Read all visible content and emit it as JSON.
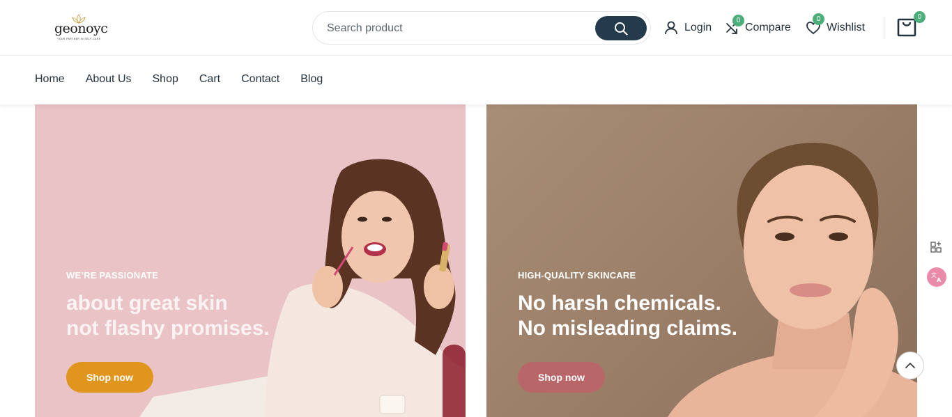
{
  "brand": {
    "logo_text": "geonoyc",
    "tagline": "YOUR PARTNER IN SELF-CARE"
  },
  "search": {
    "placeholder": "Search product"
  },
  "header_actions": {
    "login_label": "Login",
    "compare_label": "Compare",
    "compare_count": "0",
    "wishlist_label": "Wishlist",
    "wishlist_count": "0",
    "cart_count": "0"
  },
  "nav": {
    "items": [
      {
        "label": "Home"
      },
      {
        "label": "About Us"
      },
      {
        "label": "Shop"
      },
      {
        "label": "Cart"
      },
      {
        "label": "Contact"
      },
      {
        "label": "Blog"
      }
    ]
  },
  "banners": [
    {
      "kicker": "WE’RE PASSIONATE",
      "title_line1": "about great skin",
      "title_line2": "not flashy promises.",
      "button_label": "Shop now",
      "background_color": "#e9c3c6",
      "button_color": "#e0961c"
    },
    {
      "kicker": "HIGH-QUALITY SKINCARE",
      "title_line1": "No harsh chemicals.",
      "title_line2": "No misleading claims.",
      "button_label": "Shop now",
      "background_color": "#a88e77",
      "button_color": "#b96669"
    }
  ],
  "colors": {
    "primary_dark": "#243b4c",
    "badge_green": "#4caf7a"
  },
  "icons": [
    "search-icon",
    "user-icon",
    "compare-icon",
    "heart-icon",
    "shopping-bag-icon",
    "apps-icon",
    "translate-icon",
    "chevron-up-icon"
  ]
}
